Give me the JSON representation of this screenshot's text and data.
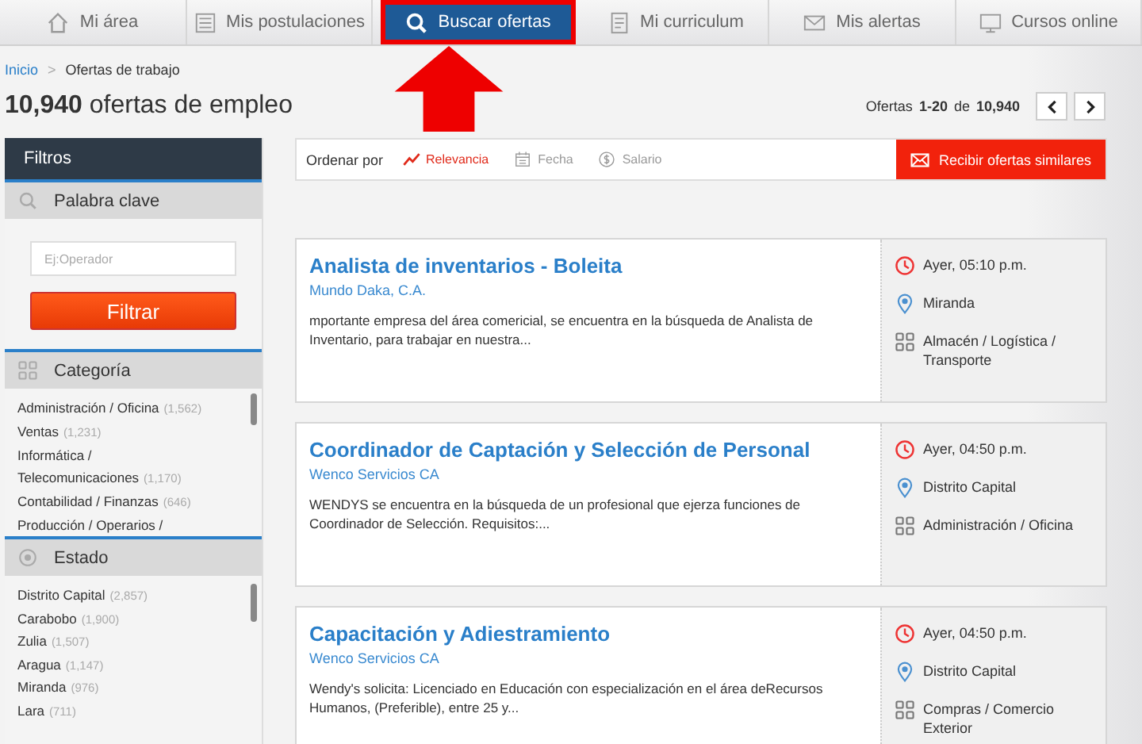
{
  "tabs": [
    {
      "label": "Mi área",
      "selected": false
    },
    {
      "label": "Mis postulaciones",
      "selected": false
    },
    {
      "label": "Buscar ofertas",
      "selected": true
    },
    {
      "label": "Mi curriculum",
      "selected": false
    },
    {
      "label": "Mis alertas",
      "selected": false
    },
    {
      "label": "Cursos online",
      "selected": false
    }
  ],
  "breadcrumb": {
    "home": "Inicio",
    "separator": ">",
    "current": "Ofertas de trabajo"
  },
  "heading": {
    "count": "10,940",
    "label": "ofertas de empleo"
  },
  "pagination": {
    "label": "Ofertas",
    "range": "1-20",
    "of": "de",
    "total": "10,940"
  },
  "filters": {
    "title": "Filtros",
    "keyword": {
      "title": "Palabra clave",
      "placeholder": "Ej:Operador",
      "button": "Filtrar"
    },
    "sections": [
      {
        "title": "Categoría",
        "items": [
          {
            "name": "Administración / Oficina",
            "count": "(1,562)"
          },
          {
            "name": "Ventas",
            "count": "(1,231)"
          },
          {
            "name": "Informática / Telecomunicaciones",
            "count": "(1,170)"
          },
          {
            "name": "Contabilidad / Finanzas",
            "count": "(646)"
          },
          {
            "name": "Producción / Operarios /"
          }
        ]
      },
      {
        "title": "Estado",
        "items": [
          {
            "name": "Distrito Capital",
            "count": "(2,857)"
          },
          {
            "name": "Carabobo",
            "count": "(1,900)"
          },
          {
            "name": "Zulia",
            "count": "(1,507)"
          },
          {
            "name": "Aragua",
            "count": "(1,147)"
          },
          {
            "name": "Miranda",
            "count": "(976)"
          },
          {
            "name": "Lara",
            "count": "(711)"
          }
        ]
      }
    ]
  },
  "sort": {
    "label": "Ordenar por",
    "options": [
      {
        "label": "Relevancia",
        "selected": true
      },
      {
        "label": "Fecha",
        "selected": false
      },
      {
        "label": "Salario",
        "selected": false
      }
    ],
    "alert_button": "Recibir ofertas similares"
  },
  "jobs": [
    {
      "title": "Analista de inventarios - Boleita",
      "company": "Mundo Daka, C.A.",
      "description": "mportante empresa del área comericial, se encuentra en la búsqueda de Analista de Inventario, para trabajar en nuestra...",
      "time": "Ayer, 05:10 p.m.",
      "location": "Miranda",
      "category": "Almacén / Logística / Transporte"
    },
    {
      "title": "Coordinador de Captación y Selección de Personal",
      "company": "Wenco Servicios CA",
      "description": "WENDYS se encuentra en la búsqueda de un profesional que ejerza funciones de Coordinador de Selección. Requisitos:...",
      "time": "Ayer, 04:50 p.m.",
      "location": "Distrito Capital",
      "category": "Administración / Oficina"
    },
    {
      "title": "Capacitación y Adiestramiento",
      "company": "Wenco Servicios CA",
      "description": "Wendy's solicita: Licenciado en Educación con especialización en el área deRecursos Humanos, (Preferible), entre 25 y...",
      "time": "Ayer, 04:50 p.m.",
      "location": "Distrito Capital",
      "category": "Compras / Comercio Exterior"
    }
  ]
}
